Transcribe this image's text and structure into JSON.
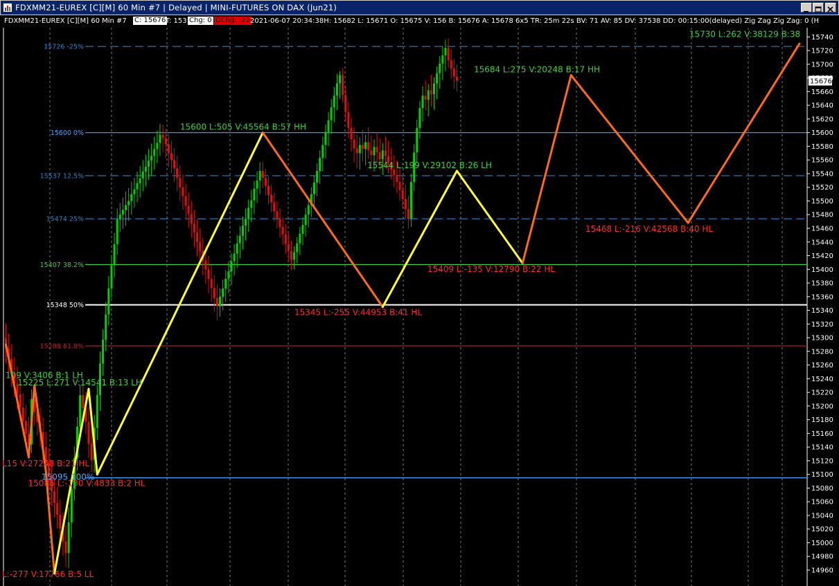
{
  "window": {
    "title": "FDXMM21-EUREX [C][M]  60 Min   #7 |  Delayed |  MINI-FUTURES ON DAX  (Jun21)"
  },
  "infobar": {
    "symbol": "FDXMM21-EUREX [C][M]   60 Min   #7",
    "close": "C: 15676",
    "ticks": "T: 153",
    "chg": "Chg: 0",
    "dchg": "DChg: -22",
    "details": "2021-06-07 20:34:38H: 15682 L: 15671 O: 15675 V: 156 B: 15676 A: 15678 6x5 TR: 25m 22s BV: 71 AV: 85 DV: 37538 DD: 00:15:00(delayed) Zig Zag    Zig Zag: 0    (H"
  },
  "chart_data": {
    "type": "candlestick",
    "ylim": [
      14940,
      15750
    ],
    "y_ticks": [
      14960,
      14980,
      15000,
      15020,
      15040,
      15060,
      15080,
      15100,
      15120,
      15140,
      15160,
      15180,
      15200,
      15220,
      15240,
      15260,
      15280,
      15300,
      15320,
      15340,
      15360,
      15380,
      15400,
      15420,
      15440,
      15460,
      15480,
      15500,
      15520,
      15540,
      15560,
      15580,
      15600,
      15620,
      15640,
      15660,
      15680,
      15700,
      15720,
      15740
    ],
    "last_price": "15676",
    "fib_levels": [
      {
        "value": 15726,
        "label": "15726 -25%",
        "color": "#2a82c8",
        "style": "dashed"
      },
      {
        "value": 15600,
        "label": "15600 0%",
        "color": "#4aa8ff",
        "style": "solid"
      },
      {
        "value": 15537,
        "label": "15537 12.5%",
        "color": "#2a82c8",
        "style": "dashed"
      },
      {
        "value": 15474,
        "label": "15474 25%",
        "color": "#2a82c8",
        "style": "dashed"
      },
      {
        "value": 15407,
        "label": "15407 38.2%",
        "color": "#3fcf3f",
        "style": "solid"
      },
      {
        "value": 15348,
        "label": "15348 50%",
        "color": "#ffffff",
        "style": "solid"
      },
      {
        "value": 15288,
        "label": "15288 61.8%",
        "color": "#c81e1e",
        "style": "solid"
      },
      {
        "value": 15095,
        "label": "15095 100%",
        "color": "#4aa8ff",
        "style": "solid"
      }
    ],
    "zigzag": [
      {
        "x": 0,
        "y": 15290,
        "color": "#ff6a1a"
      },
      {
        "x": 8,
        "y": 15125,
        "color": "#ff6a1a"
      },
      {
        "x": 10,
        "y": 15230,
        "color": "#ff6a1a"
      },
      {
        "x": 14,
        "y": 15105,
        "color": "#ff6a1a"
      },
      {
        "x": 17,
        "y": 14955,
        "color": "#ff6a1a"
      },
      {
        "x": 29,
        "y": 15225,
        "color": "#ffff33"
      },
      {
        "x": 32,
        "y": 15100,
        "color": "#ffff33"
      },
      {
        "x": 90,
        "y": 15600,
        "color": "#ffff33"
      },
      {
        "x": 132,
        "y": 15345,
        "color": "#ff6a1a"
      },
      {
        "x": 158,
        "y": 15544,
        "color": "#ffff33"
      },
      {
        "x": 181,
        "y": 15409,
        "color": "#ffff33"
      },
      {
        "x": 198,
        "y": 15684,
        "color": "#ff6a1a"
      },
      {
        "x": 239,
        "y": 15468,
        "color": "#ff6a1a"
      },
      {
        "x": 278,
        "y": 15730,
        "color": "#ff6a1a"
      }
    ],
    "annotations": [
      {
        "text": "15730 L:262 V:38129 B:38",
        "color": "#3fcf3f",
        "x": 1075,
        "y": 15740,
        "anchor": "middle"
      },
      {
        "text": "15684 L:275 V:20248 B:17  HH",
        "color": "#3fcf3f",
        "x": 775,
        "y": 15688,
        "anchor": "middle"
      },
      {
        "text": "15600 L:505 V:45564 B:57  HH",
        "color": "#3fcf3f",
        "x": 351,
        "y": 15604,
        "anchor": "middle"
      },
      {
        "text": "15544 L:199 V:29102 B:26  LH",
        "color": "#3fcf3f",
        "x": 620,
        "y": 15548,
        "anchor": "middle"
      },
      {
        "text": "15468 L:-216 V:42568 B:40  HL",
        "color": "#ff2a2a",
        "x": 937,
        "y": 15455,
        "anchor": "middle"
      },
      {
        "text": "15409 L:-135 V:12790 B:22  HL",
        "color": "#ff2a2a",
        "x": 709,
        "y": 15396,
        "anchor": "middle"
      },
      {
        "text": "15345 L:-255 V:44953 B:41  HL",
        "color": "#ff2a2a",
        "x": 517,
        "y": 15333,
        "anchor": "middle"
      },
      {
        "text": "109 V:3406 B:1  LH",
        "color": "#3fcf3f",
        "x": 8,
        "y": 15241,
        "anchor": "start"
      },
      {
        "text": "15225 L:271 V:14541 B:13  LH",
        "color": "#3fcf3f",
        "x": 115,
        "y": 15230,
        "anchor": "middle"
      },
      {
        "text": "L15 V:27248 B:21  HL",
        "color": "#ff2a2a",
        "x": 3,
        "y": 15112,
        "anchor": "start"
      },
      {
        "text": "15095 100%",
        "color": "#4aa8ff",
        "x": 60,
        "y": 15092,
        "anchor": "start"
      },
      {
        "text": "15085 L:-130 V:4833 B:2  HL",
        "color": "#ff2a2a",
        "x": 125,
        "y": 15083,
        "anchor": "middle"
      },
      {
        "text": "L:-277 V:17766 B:5  LL",
        "color": "#ff2a2a",
        "x": 3,
        "y": 14950,
        "anchor": "start"
      }
    ],
    "candles": [
      [
        15299,
        15321,
        15263,
        15284
      ],
      [
        15284,
        15306,
        15248,
        15269
      ],
      [
        15269,
        15291,
        15228,
        15248
      ],
      [
        15248,
        15272,
        15213,
        15233
      ],
      [
        15233,
        15258,
        15196,
        15217
      ],
      [
        15217,
        15240,
        15178,
        15198
      ],
      [
        15198,
        15219,
        15158,
        15178
      ],
      [
        15178,
        15202,
        15141,
        15159
      ],
      [
        15159,
        15184,
        15123,
        15144
      ],
      [
        15144,
        15224,
        15131,
        15210
      ],
      [
        15210,
        15232,
        15171,
        15191
      ],
      [
        15191,
        15214,
        15157,
        15177
      ],
      [
        15177,
        15198,
        15140,
        15162
      ],
      [
        15162,
        15184,
        15121,
        15140
      ],
      [
        15140,
        15162,
        15101,
        15117
      ],
      [
        15117,
        15138,
        15078,
        15099
      ],
      [
        15099,
        15121,
        15054,
        15075
      ],
      [
        15075,
        15096,
        15037,
        15058
      ],
      [
        15058,
        15082,
        15021,
        15041
      ],
      [
        15041,
        15063,
        15001,
        15021
      ],
      [
        15021,
        15044,
        14981,
        15002
      ],
      [
        15002,
        15026,
        14965,
        14985
      ],
      [
        14985,
        15052,
        14963,
        15030
      ],
      [
        15030,
        15095,
        15008,
        15079
      ],
      [
        15079,
        15141,
        15061,
        15124
      ],
      [
        15124,
        15184,
        15106,
        15170
      ],
      [
        15170,
        15231,
        15150,
        15216
      ],
      [
        15216,
        15238,
        15177,
        15197
      ],
      [
        15197,
        15221,
        15159,
        15177
      ],
      [
        15177,
        15199,
        15124,
        15145
      ],
      [
        15145,
        15166,
        15103,
        15121
      ],
      [
        15121,
        15187,
        15103,
        15168
      ],
      [
        15168,
        15231,
        15150,
        15216
      ],
      [
        15216,
        15280,
        15193,
        15262
      ],
      [
        15262,
        15312,
        15244,
        15297
      ],
      [
        15297,
        15352,
        15280,
        15334
      ],
      [
        15334,
        15390,
        15318,
        15372
      ],
      [
        15372,
        15421,
        15358,
        15406
      ],
      [
        15406,
        15453,
        15388,
        15437
      ],
      [
        15437,
        15489,
        15421,
        15473
      ],
      [
        15473,
        15497,
        15455,
        15480
      ],
      [
        15480,
        15505,
        15459,
        15487
      ],
      [
        15487,
        15514,
        15464,
        15494
      ],
      [
        15494,
        15519,
        15471,
        15500
      ],
      [
        15500,
        15528,
        15480,
        15510
      ],
      [
        15510,
        15534,
        15490,
        15517
      ],
      [
        15517,
        15543,
        15498,
        15526
      ],
      [
        15526,
        15551,
        15505,
        15533
      ],
      [
        15533,
        15560,
        15514,
        15543
      ],
      [
        15543,
        15568,
        15521,
        15550
      ],
      [
        15550,
        15576,
        15531,
        15559
      ],
      [
        15559,
        15584,
        15537,
        15566
      ],
      [
        15566,
        15594,
        15546,
        15576
      ],
      [
        15576,
        15603,
        15555,
        15585
      ],
      [
        15585,
        15613,
        15566,
        15597
      ],
      [
        15597,
        15612,
        15571,
        15592
      ],
      [
        15592,
        15606,
        15563,
        15583
      ],
      [
        15583,
        15598,
        15550,
        15570
      ],
      [
        15570,
        15588,
        15541,
        15560
      ],
      [
        15560,
        15577,
        15528,
        15548
      ],
      [
        15548,
        15566,
        15514,
        15534
      ],
      [
        15534,
        15552,
        15500,
        15520
      ],
      [
        15520,
        15539,
        15487,
        15507
      ],
      [
        15507,
        15525,
        15473,
        15493
      ],
      [
        15493,
        15513,
        15461,
        15481
      ],
      [
        15481,
        15500,
        15446,
        15467
      ],
      [
        15467,
        15487,
        15433,
        15454
      ],
      [
        15454,
        15473,
        15419,
        15440
      ],
      [
        15440,
        15460,
        15406,
        15427
      ],
      [
        15427,
        15446,
        15392,
        15413
      ],
      [
        15413,
        15433,
        15379,
        15400
      ],
      [
        15400,
        15420,
        15365,
        15386
      ],
      [
        15386,
        15406,
        15352,
        15373
      ],
      [
        15373,
        15392,
        15338,
        15358
      ],
      [
        15358,
        15378,
        15325,
        15346
      ],
      [
        15346,
        15372,
        15331,
        15360
      ],
      [
        15360,
        15385,
        15340,
        15372
      ],
      [
        15372,
        15399,
        15352,
        15386
      ],
      [
        15386,
        15411,
        15365,
        15397
      ],
      [
        15397,
        15424,
        15377,
        15412
      ],
      [
        15412,
        15437,
        15391,
        15423
      ],
      [
        15423,
        15450,
        15402,
        15438
      ],
      [
        15438,
        15463,
        15416,
        15449
      ],
      [
        15449,
        15477,
        15429,
        15464
      ],
      [
        15464,
        15489,
        15442,
        15474
      ],
      [
        15474,
        15502,
        15455,
        15490
      ],
      [
        15490,
        15516,
        15469,
        15501
      ],
      [
        15501,
        15529,
        15481,
        15518
      ],
      [
        15518,
        15543,
        15497,
        15530
      ],
      [
        15530,
        15557,
        15510,
        15544
      ],
      [
        15544,
        15557,
        15519,
        15534
      ],
      [
        15534,
        15547,
        15508,
        15522
      ],
      [
        15522,
        15536,
        15495,
        15509
      ],
      [
        15509,
        15524,
        15484,
        15498
      ],
      [
        15498,
        15512,
        15470,
        15485
      ],
      [
        15485,
        15500,
        15460,
        15474
      ],
      [
        15474,
        15489,
        15447,
        15462
      ],
      [
        15462,
        15477,
        15436,
        15451
      ],
      [
        15451,
        15466,
        15423,
        15437
      ],
      [
        15437,
        15453,
        15412,
        15427
      ],
      [
        15427,
        15442,
        15399,
        15414
      ],
      [
        15414,
        15434,
        15400,
        15425
      ],
      [
        15425,
        15447,
        15409,
        15438
      ],
      [
        15438,
        15462,
        15421,
        15452
      ],
      [
        15452,
        15476,
        15435,
        15465
      ],
      [
        15465,
        15490,
        15448,
        15480
      ],
      [
        15480,
        15504,
        15461,
        15494
      ],
      [
        15494,
        15520,
        15476,
        15510
      ],
      [
        15510,
        15537,
        15491,
        15527
      ],
      [
        15527,
        15555,
        15507,
        15544
      ],
      [
        15544,
        15574,
        15525,
        15563
      ],
      [
        15563,
        15594,
        15543,
        15582
      ],
      [
        15582,
        15612,
        15562,
        15601
      ],
      [
        15601,
        15630,
        15580,
        15618
      ],
      [
        15618,
        15649,
        15598,
        15637
      ],
      [
        15637,
        15667,
        15615,
        15654
      ],
      [
        15654,
        15686,
        15633,
        15672
      ],
      [
        15672,
        15690,
        15650,
        15684
      ],
      [
        15684,
        15694,
        15645,
        15655
      ],
      [
        15655,
        15668,
        15617,
        15630
      ],
      [
        15630,
        15645,
        15592,
        15607
      ],
      [
        15607,
        15622,
        15572,
        15590
      ],
      [
        15590,
        15608,
        15556,
        15577
      ],
      [
        15577,
        15597,
        15548,
        15570
      ],
      [
        15570,
        15593,
        15546,
        15582
      ],
      [
        15582,
        15604,
        15558,
        15576
      ],
      [
        15576,
        15597,
        15552,
        15586
      ],
      [
        15586,
        15608,
        15561,
        15574
      ],
      [
        15574,
        15596,
        15548,
        15567
      ],
      [
        15567,
        15590,
        15543,
        15579
      ],
      [
        15579,
        15601,
        15556,
        15571
      ],
      [
        15571,
        15592,
        15546,
        15561
      ],
      [
        15561,
        15585,
        15538,
        15574
      ],
      [
        15574,
        15594,
        15548,
        15566
      ],
      [
        15566,
        15588,
        15541,
        15556
      ],
      [
        15556,
        15578,
        15532,
        15546
      ],
      [
        15546,
        15567,
        15520,
        15538
      ],
      [
        15538,
        15560,
        15512,
        15528
      ],
      [
        15528,
        15548,
        15500,
        15516
      ],
      [
        15516,
        15537,
        15489,
        15503
      ],
      [
        15503,
        15524,
        15474,
        15488
      ],
      [
        15488,
        15508,
        15460,
        15474
      ],
      [
        15474,
        15540,
        15462,
        15528
      ],
      [
        15528,
        15583,
        15514,
        15571
      ],
      [
        15571,
        15619,
        15556,
        15607
      ],
      [
        15607,
        15646,
        15591,
        15636
      ],
      [
        15636,
        15668,
        15616,
        15654
      ],
      [
        15654,
        15677,
        15632,
        15648
      ],
      [
        15648,
        15671,
        15624,
        15662
      ],
      [
        15662,
        15685,
        15638,
        15656
      ],
      [
        15656,
        15681,
        15634,
        15672
      ],
      [
        15672,
        15697,
        15649,
        15687
      ],
      [
        15687,
        15712,
        15664,
        15701
      ],
      [
        15701,
        15726,
        15677,
        15713
      ],
      [
        15713,
        15736,
        15690,
        15724
      ],
      [
        15724,
        15738,
        15695,
        15706
      ],
      [
        15706,
        15722,
        15678,
        15694
      ],
      [
        15694,
        15708,
        15664,
        15682
      ],
      [
        15682,
        15700,
        15660,
        15676
      ]
    ]
  }
}
